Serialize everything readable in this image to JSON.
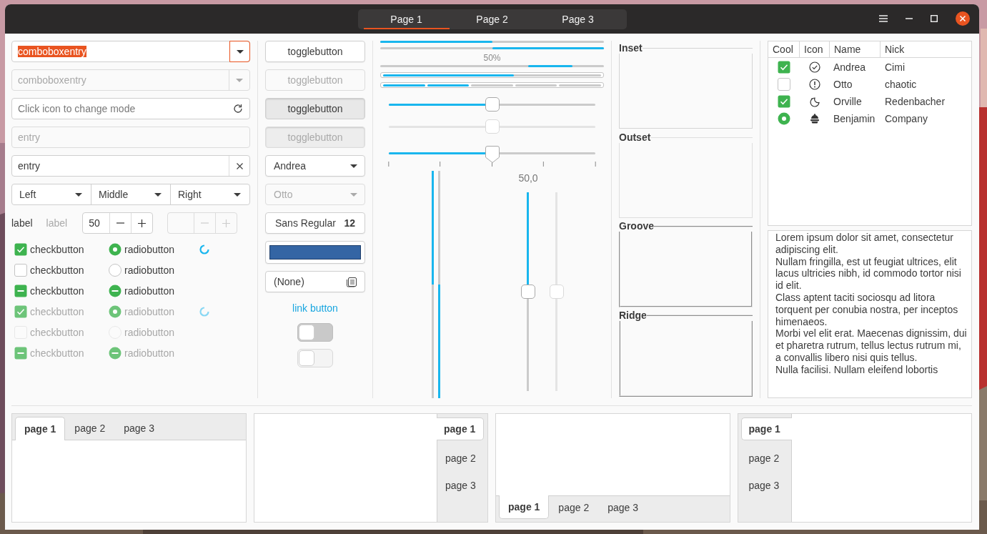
{
  "header": {
    "tabs": [
      {
        "label": "Page 1",
        "selected": true
      },
      {
        "label": "Page 2",
        "selected": false
      },
      {
        "label": "Page 3",
        "selected": false
      }
    ]
  },
  "combo_entries": [
    {
      "value": "comboboxentry",
      "focused": true,
      "disabled": false
    },
    {
      "value": "comboboxentry",
      "focused": false,
      "disabled": true
    }
  ],
  "mode_entry": {
    "placeholder": "Click icon to change mode"
  },
  "entries": [
    {
      "value": "entry",
      "disabled": true,
      "clear_icon": false
    },
    {
      "value": "entry",
      "disabled": false,
      "clear_icon": true
    }
  ],
  "linked_combos": [
    {
      "label": "Left"
    },
    {
      "label": "Middle"
    },
    {
      "label": "Right"
    }
  ],
  "labels": [
    {
      "text": "label",
      "disabled": false
    },
    {
      "text": "label",
      "disabled": true
    }
  ],
  "spin_buttons": [
    {
      "value": "50",
      "disabled": false
    },
    {
      "disabled": true
    }
  ],
  "check_rows": [
    {
      "check": {
        "label": "checkbutton",
        "checked": true,
        "inconsistent": false
      },
      "radio": {
        "label": "radiobutton",
        "checked": true,
        "inconsistent": false
      },
      "disabled": false,
      "spinner": true
    },
    {
      "check": {
        "label": "checkbutton",
        "checked": false,
        "inconsistent": false
      },
      "radio": {
        "label": "radiobutton",
        "checked": false,
        "inconsistent": false
      },
      "disabled": false,
      "spinner": false
    },
    {
      "check": {
        "label": "checkbutton",
        "inconsistent": true
      },
      "radio": {
        "label": "radiobutton",
        "inconsistent": true
      },
      "disabled": false,
      "spinner": false
    },
    {
      "check": {
        "label": "checkbutton",
        "checked": true,
        "inconsistent": false
      },
      "radio": {
        "label": "radiobutton",
        "checked": true,
        "inconsistent": false
      },
      "disabled": true,
      "spinner": true
    },
    {
      "check": {
        "label": "checkbutton",
        "checked": false,
        "inconsistent": false
      },
      "radio": {
        "label": "radiobutton",
        "checked": false,
        "inconsistent": false
      },
      "disabled": true,
      "spinner": false
    },
    {
      "check": {
        "label": "checkbutton",
        "inconsistent": true
      },
      "radio": {
        "label": "radiobutton",
        "inconsistent": true
      },
      "disabled": true,
      "spinner": false
    }
  ],
  "toggle_buttons": [
    {
      "label": "togglebutton",
      "active": false,
      "disabled": false
    },
    {
      "label": "togglebutton",
      "active": false,
      "disabled": true
    },
    {
      "label": "togglebutton",
      "active": true,
      "disabled": false
    },
    {
      "label": "togglebutton",
      "active": true,
      "disabled": true
    }
  ],
  "combos": [
    {
      "value": "Andrea",
      "disabled": false
    },
    {
      "value": "Otto",
      "disabled": true
    }
  ],
  "font_button": {
    "family": "Sans Regular",
    "size": "12"
  },
  "color_button": {
    "color": "#3465a4"
  },
  "file_button": {
    "value": "(None)"
  },
  "link_button": {
    "label": "link button"
  },
  "switches": [
    {
      "on": false,
      "disabled": false
    },
    {
      "on": false,
      "disabled": true
    }
  ],
  "progress_bars": [
    {
      "kind": "plain",
      "level": 0.5,
      "inverted": false
    },
    {
      "kind": "plain",
      "level": 0.5,
      "inverted": true
    },
    {
      "kind": "pulse",
      "text": "50%"
    },
    {
      "kind": "framed",
      "level": 0.6
    },
    {
      "kind": "segmented",
      "level": 0.4
    }
  ],
  "scales": [
    {
      "kind": "plain",
      "level": 0.5,
      "disabled": false
    },
    {
      "kind": "plain",
      "level": 0.5,
      "disabled": true
    },
    {
      "kind": "marks",
      "level": 0.5,
      "disabled": false
    }
  ],
  "vertical_progress": [
    {
      "level": 0.5,
      "inverted": false
    },
    {
      "level": 0.5,
      "inverted": true
    }
  ],
  "vertical_scales": [
    {
      "level": 0.5,
      "value": "50,0",
      "disabled": false
    },
    {
      "level": 0.5,
      "disabled": true
    }
  ],
  "frames": [
    {
      "label": "Inset",
      "kind": "inset"
    },
    {
      "label": "Outset",
      "kind": "outset"
    },
    {
      "label": "Groove",
      "kind": "groove"
    },
    {
      "label": "Ridge",
      "kind": "ridge"
    }
  ],
  "tree": {
    "columns": [
      "Cool",
      "Icon",
      "Name",
      "Nick"
    ],
    "rows": [
      {
        "cool": {
          "kind": "check",
          "checked": true
        },
        "name": "Andrea",
        "nick": "Cimi"
      },
      {
        "cool": {
          "kind": "check",
          "checked": false
        },
        "name": "Otto",
        "nick": "chaotic"
      },
      {
        "cool": {
          "kind": "check",
          "checked": true
        },
        "name": "Orville",
        "nick": "Redenbacher"
      },
      {
        "cool": {
          "kind": "radio",
          "checked": true
        },
        "name": "Benjamin",
        "nick": "Company"
      }
    ]
  },
  "text_view": {
    "paragraphs": [
      "Lorem ipsum dolor sit amet, consectetur adipiscing elit.",
      "Nullam fringilla, est ut feugiat ultrices, elit lacus ultricies nibh, id commodo tortor nisi id elit.",
      "Class aptent taciti sociosqu ad litora torquent per conubia nostra, per inceptos himenaeos.",
      "Morbi vel elit erat. Maecenas dignissim, dui et pharetra rutrum, tellus lectus rutrum mi, a convallis libero nisi quis tellus.",
      "Nulla facilisi. Nullam eleifend lobortis"
    ]
  },
  "notebooks": [
    {
      "kind": "top",
      "tabs": [
        {
          "label": "page 1",
          "selected": true
        },
        {
          "label": "page 2",
          "selected": false
        },
        {
          "label": "page 3",
          "selected": false
        }
      ]
    },
    {
      "kind": "right",
      "tabs": [
        {
          "label": "page 1",
          "selected": true
        },
        {
          "label": "page 2",
          "selected": false
        },
        {
          "label": "page 3",
          "selected": false
        }
      ]
    },
    {
      "kind": "bottom",
      "tabs": [
        {
          "label": "page 1",
          "selected": true
        },
        {
          "label": "page 2",
          "selected": false
        },
        {
          "label": "page 3",
          "selected": false
        }
      ]
    },
    {
      "kind": "left",
      "tabs": [
        {
          "label": "page 1",
          "selected": true
        },
        {
          "label": "page 2",
          "selected": false
        },
        {
          "label": "page 3",
          "selected": false
        }
      ]
    }
  ]
}
